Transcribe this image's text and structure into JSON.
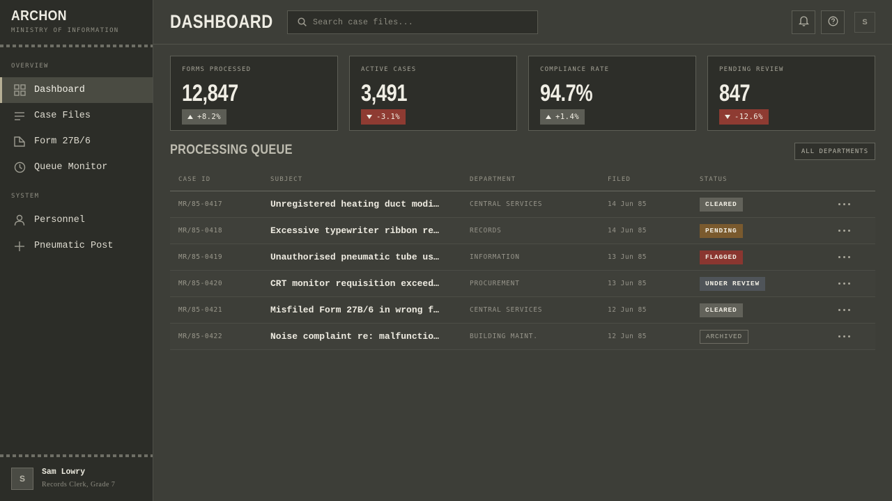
{
  "brand": {
    "title": "ARCHON",
    "subtitle": "MINISTRY OF INFORMATION"
  },
  "sidebar": {
    "sections": [
      {
        "label": "OVERVIEW"
      },
      {
        "label": "SYSTEM"
      }
    ],
    "items": [
      {
        "label": "Dashboard",
        "icon": "grid-icon",
        "active": true
      },
      {
        "label": "Case Files",
        "icon": "lines-icon"
      },
      {
        "label": "Form 27B/6",
        "icon": "document-icon"
      },
      {
        "label": "Queue Monitor",
        "icon": "clock-icon"
      },
      {
        "label": "Personnel",
        "icon": "person-icon"
      },
      {
        "label": "Pneumatic Post",
        "icon": "plus-icon"
      }
    ]
  },
  "user": {
    "initial": "S",
    "name": "Sam Lowry",
    "role": "Records Clerk, Grade 7"
  },
  "header": {
    "title": "DASHBOARD",
    "search_placeholder": "Search case files...",
    "icons": [
      "bell-icon",
      "help-icon"
    ],
    "account_initial": "S"
  },
  "stats": [
    {
      "label": "FORMS PROCESSED",
      "value": "12,847",
      "delta": "+8.2%",
      "direction": "up"
    },
    {
      "label": "ACTIVE CASES",
      "value": "3,491",
      "delta": "-3.1%",
      "direction": "down"
    },
    {
      "label": "COMPLIANCE RATE",
      "value": "94.7%",
      "delta": "+1.4%",
      "direction": "up"
    },
    {
      "label": "PENDING REVIEW",
      "value": "847",
      "delta": "-12.6%",
      "direction": "down"
    }
  ],
  "queue": {
    "title": "PROCESSING QUEUE",
    "filter_label": "ALL DEPARTMENTS",
    "columns": [
      "CASE ID",
      "SUBJECT",
      "DEPARTMENT",
      "FILED",
      "STATUS"
    ],
    "rows": [
      {
        "id": "MR/85-0417",
        "subject": "Unregistered heating duct modi…",
        "dept": "CENTRAL SERVICES",
        "filed": "14 Jun 85",
        "status": "CLEARED",
        "status_kind": "cleared"
      },
      {
        "id": "MR/85-0418",
        "subject": "Excessive typewriter ribbon re…",
        "dept": "RECORDS",
        "filed": "14 Jun 85",
        "status": "PENDING",
        "status_kind": "pending"
      },
      {
        "id": "MR/85-0419",
        "subject": "Unauthorised pneumatic tube us…",
        "dept": "INFORMATION",
        "filed": "13 Jun 85",
        "status": "FLAGGED",
        "status_kind": "flagged"
      },
      {
        "id": "MR/85-0420",
        "subject": "CRT monitor requisition exceed…",
        "dept": "PROCUREMENT",
        "filed": "13 Jun 85",
        "status": "UNDER REVIEW",
        "status_kind": "review"
      },
      {
        "id": "MR/85-0421",
        "subject": "Misfiled Form 27B/6 in wrong f…",
        "dept": "CENTRAL SERVICES",
        "filed": "12 Jun 85",
        "status": "CLEARED",
        "status_kind": "cleared"
      },
      {
        "id": "MR/85-0422",
        "subject": "Noise complaint re: malfunctio…",
        "dept": "BUILDING MAINT.",
        "filed": "12 Jun 85",
        "status": "ARCHIVED",
        "status_kind": "archived"
      }
    ]
  },
  "colors": {
    "background": "#3d3e38",
    "sidebar": "#2c2d28",
    "negative": "#8e3b32",
    "pending": "#7a5a2e",
    "review": "#4f5459"
  }
}
